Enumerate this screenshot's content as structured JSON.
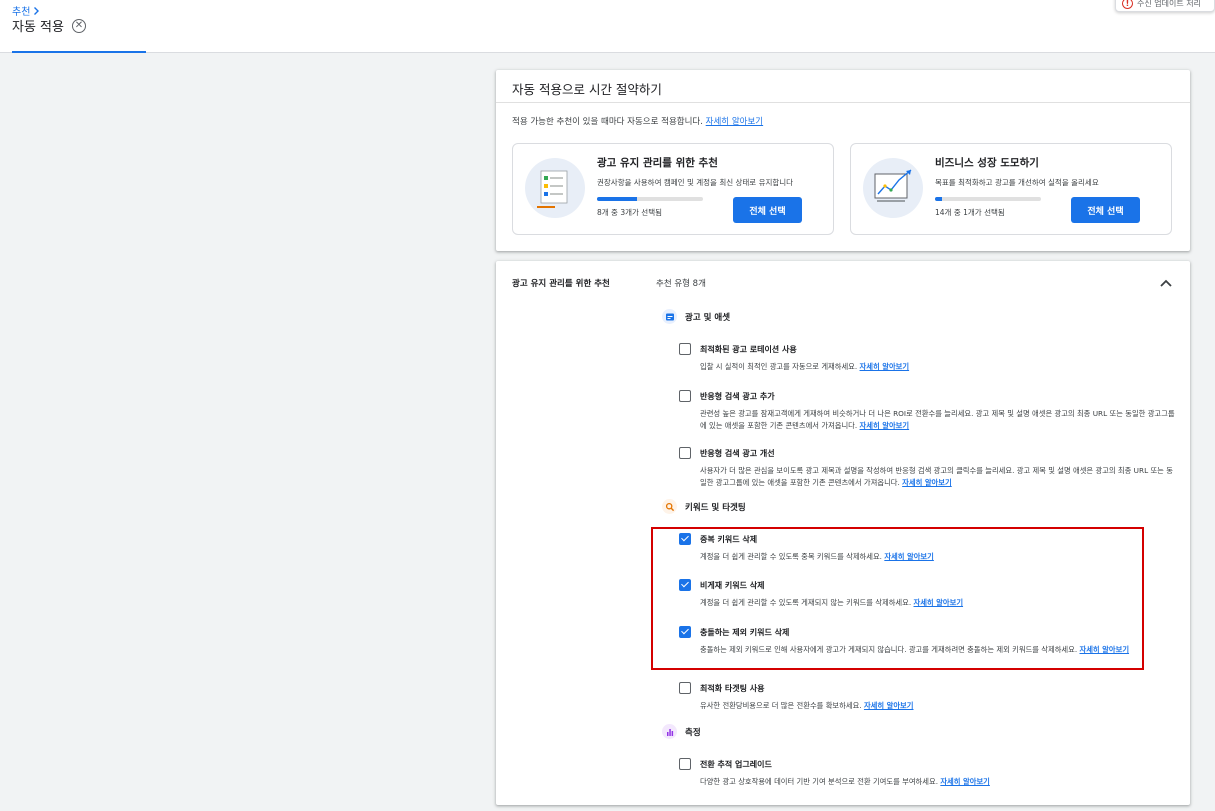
{
  "header": {
    "breadcrumb": "추천",
    "title": "자동 적용",
    "toast_text": "수신 업데이트 처리"
  },
  "auto_apply": {
    "heading": "자동 적용으로 시간 절약하기",
    "description": "적용 가능한 추천이 있을 때마다 자동으로 적용합니다.",
    "learn_more": "자세히 알아보기",
    "cards": [
      {
        "title": "광고 유지 관리를 위한 추천",
        "desc": "권장사항을 사용하여 캠페인 및 계정을 최신 상태로 유지합니다",
        "count": "8개 중 3개가 선택됨",
        "progress": 0.375,
        "button": "전체 선택"
      },
      {
        "title": "비즈니스 성장 도모하기",
        "desc": "목표를 최적화하고 광고를 개선하여 실적을 올리세요",
        "count": "14개 중 1개가 선택됨",
        "progress": 0.07,
        "button": "전체 선택"
      }
    ]
  },
  "maintenance": {
    "label": "광고 유지 관리를 위한 추천",
    "type_count": "추천 유형 8개",
    "learn_more": "자세히 알아보기",
    "categories": [
      {
        "name": "광고 및 애셋",
        "icon": "ads-assets-icon",
        "color": "#1a73e8"
      },
      {
        "name": "키워드 및 타겟팅",
        "icon": "search-icon",
        "color": "#e37400"
      },
      {
        "name": "측정",
        "icon": "bar-chart-icon",
        "color": "#9334e6"
      }
    ],
    "items": [
      {
        "title": "최적화된 광고 로테이션 사용",
        "desc": "입찰 시 실적이 최적인 광고를 자동으로 게재하세요.",
        "checked": false
      },
      {
        "title": "반응형 검색 광고 추가",
        "desc": "관련성 높은 광고를 잠재고객에게 게재하여 비슷하거나 더 나은 ROI로 전환수를 늘리세요. 광고 제목 및 설명 애셋은 광고의 최종 URL 또는 동일한 광고그룹에 있는 애셋을 포함한 기존 콘텐츠에서 가져옵니다.",
        "checked": false
      },
      {
        "title": "반응형 검색 광고 개선",
        "desc": "사용자가 더 많은 관심을 보이도록 광고 제목과 설명을 작성하여 반응형 검색 광고의 클릭수를 늘리세요. 광고 제목 및 설명 애셋은 광고의 최종 URL 또는 동일한 광고그룹에 있는 애셋을 포함한 기존 콘텐츠에서 가져옵니다.",
        "checked": false
      },
      {
        "title": "중복 키워드 삭제",
        "desc": "계정을 더 쉽게 관리할 수 있도록 중복 키워드를 삭제하세요.",
        "checked": true
      },
      {
        "title": "비게재 키워드 삭제",
        "desc": "계정을 더 쉽게 관리할 수 있도록 게재되지 않는 키워드를 삭제하세요.",
        "checked": true
      },
      {
        "title": "충돌하는 제외 키워드 삭제",
        "desc": "충돌하는 제외 키워드로 인해 사용자에게 광고가 게재되지 않습니다. 광고를 게재하려면 충돌하는 제외 키워드를 삭제하세요.",
        "checked": true
      },
      {
        "title": "최적화 타겟팅 사용",
        "desc": "유사한 전환당비용으로 더 많은 전환수를 확보하세요.",
        "checked": false
      },
      {
        "title": "전환 추적 업그레이드",
        "desc": "다양한 광고 상호작용에 데이터 기반 기여 분석으로 전환 기여도를 부여하세요.",
        "checked": false
      }
    ]
  },
  "colors": {
    "accent": "#1a73e8",
    "highlight": "#d40000"
  }
}
